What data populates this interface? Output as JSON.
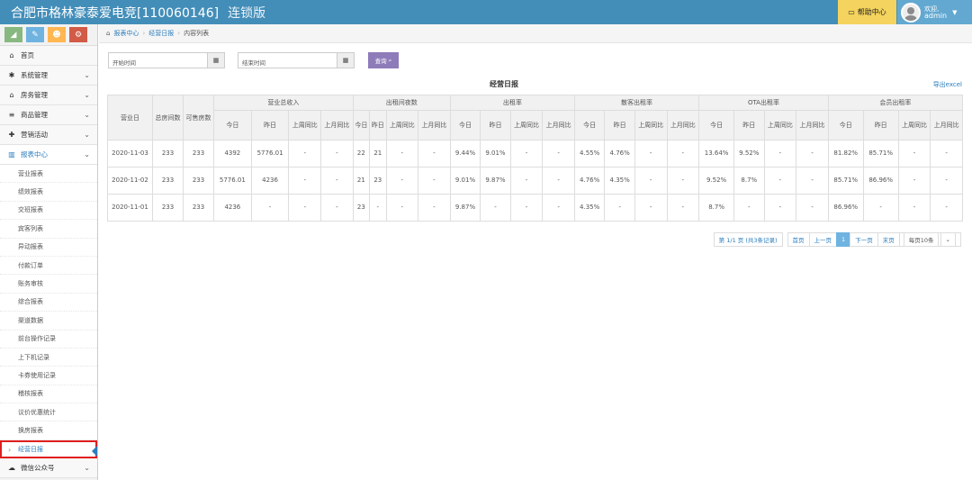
{
  "header": {
    "title": "合肥市格林豪泰爱电竞[110060146]",
    "edition": "连锁版",
    "help_label": "帮助中心",
    "welcome": "欢迎,",
    "username": "admin"
  },
  "sidebar": {
    "items": [
      {
        "label": "首页",
        "icon": "home-icon"
      },
      {
        "label": "系统管理",
        "icon": "gear-icon"
      },
      {
        "label": "房务管理",
        "icon": "building-icon"
      },
      {
        "label": "商品管理",
        "icon": "database-icon"
      },
      {
        "label": "营销活动",
        "icon": "gift-icon"
      },
      {
        "label": "报表中心",
        "icon": "bar-chart-icon"
      }
    ],
    "sub_items": [
      "营业报表",
      "绩效报表",
      "交班报表",
      "宾客列表",
      "异动报表",
      "付款订单",
      "账务审核",
      "综合报表",
      "渠道数据",
      "前台操作记录",
      "上下机记录",
      "卡券使用记录",
      "稽核报表",
      "议价优惠统计",
      "换房报表",
      "经营日报"
    ],
    "after_label": "微信公众号"
  },
  "breadcrumb": {
    "items": [
      "报表中心",
      "经营日报",
      "内容列表"
    ]
  },
  "filters": {
    "start_placeholder": "开始时间",
    "end_placeholder": "结束时间",
    "query_label": "查询"
  },
  "report": {
    "title": "经营日报",
    "export_label": "导出excel",
    "col_headers": {
      "date": "营业日",
      "total_rooms": "总房间数",
      "sellable": "可售房数",
      "groups": [
        "营业总收入",
        "出租间夜数",
        "出租率",
        "散客出租率",
        "OTA出租率",
        "会员出租率"
      ],
      "sub": [
        "今日",
        "昨日",
        "上周同比",
        "上月同比"
      ]
    },
    "rows": [
      {
        "date": "2020-11-03",
        "total": "233",
        "sellable": "233",
        "cells": [
          "4392",
          "5776.01",
          "-",
          "-",
          "22",
          "21",
          "-",
          "-",
          "9.44%",
          "9.01%",
          "-",
          "-",
          "4.55%",
          "4.76%",
          "-",
          "-",
          "13.64%",
          "9.52%",
          "-",
          "-",
          "81.82%",
          "85.71%",
          "-",
          "-"
        ]
      },
      {
        "date": "2020-11-02",
        "total": "233",
        "sellable": "233",
        "cells": [
          "5776.01",
          "4236",
          "-",
          "-",
          "21",
          "23",
          "-",
          "-",
          "9.01%",
          "9.87%",
          "-",
          "-",
          "4.76%",
          "4.35%",
          "-",
          "-",
          "9.52%",
          "8.7%",
          "-",
          "-",
          "85.71%",
          "86.96%",
          "-",
          "-"
        ]
      },
      {
        "date": "2020-11-01",
        "total": "233",
        "sellable": "233",
        "cells": [
          "4236",
          "-",
          "-",
          "-",
          "23",
          "-",
          "-",
          "-",
          "9.87%",
          "-",
          "-",
          "-",
          "4.35%",
          "-",
          "-",
          "-",
          "8.7%",
          "-",
          "-",
          "-",
          "86.96%",
          "-",
          "-",
          "-"
        ]
      }
    ]
  },
  "pager": {
    "info": "第 1/1 页 (共3条记录)",
    "first": "首页",
    "prev": "上一页",
    "current": "1",
    "next": "下一页",
    "last": "末页",
    "page_size": "每页10条"
  }
}
